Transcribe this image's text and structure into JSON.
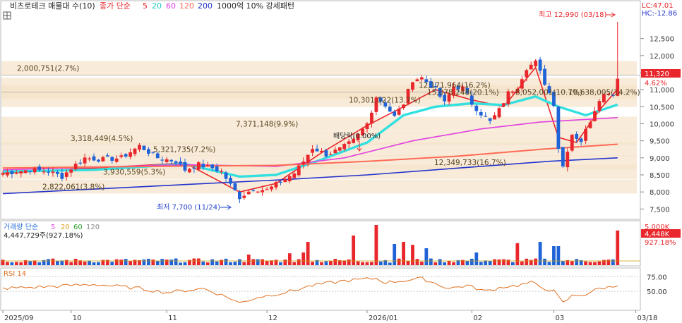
{
  "header": {
    "title": "비츠로테크 매물대 수(10)",
    "ma_label": "종가 단순",
    "ma_periods": [
      "5",
      "20",
      "60",
      "120",
      "200"
    ],
    "ma_colors": [
      "#e8262b",
      "#33e0e0",
      "#e040e0",
      "#ff6a55",
      "#2233cc"
    ],
    "overlay_label": "1000억 10% 강세패턴"
  },
  "corner": {
    "lc": "LC:47.01",
    "hc": "HC:-12.86"
  },
  "price_badge": {
    "value": "11,320",
    "pct": "4.62%"
  },
  "volume_badge": {
    "value": "4,448K",
    "pct": "927.18%"
  },
  "volume_header": {
    "label": "거래량 단순",
    "periods": [
      "5",
      "20",
      "60",
      "120"
    ],
    "info": "4,447,729주(927.18%)",
    "scale_top": "5,000K"
  },
  "rsi_header": {
    "label": "RSI 14"
  },
  "annotations": {
    "high": "최고 12,990 (03/18)",
    "low": "최저 7,700 (11/24)",
    "dividend": "배당락(0.00%)"
  },
  "chart_data": {
    "type": "candlestick",
    "price_axis": {
      "ylim": [
        7300,
        13300
      ],
      "ticks": [
        7500,
        8000,
        8500,
        9000,
        9500,
        10000,
        10500,
        11000,
        11500,
        12000,
        12500
      ],
      "tick_labels": [
        "7,500",
        "8,000",
        "8,500",
        "9,000",
        "9,500",
        "10,000",
        "10,500",
        "11,000",
        "11,500",
        "12,000",
        "12,500"
      ]
    },
    "x_axis": {
      "n_sessions": 136,
      "labels": [
        {
          "text": "2025/09",
          "index": 0
        },
        {
          "text": "10",
          "index": 15
        },
        {
          "text": "11",
          "index": 36
        },
        {
          "text": "12",
          "index": 58
        },
        {
          "text": "2026/01",
          "index": 80
        },
        {
          "text": "02",
          "index": 103
        },
        {
          "text": "03",
          "index": 121
        },
        {
          "text": "03/18",
          "index": 139
        }
      ]
    },
    "volume_profile": [
      {
        "text": "2,000,751(2.7%)",
        "price": 11630
      },
      {
        "text": "12,171,964(16.2%)",
        "price": 11140
      },
      {
        "text": "15,078,248(20.1%)",
        "price": 10930
      },
      {
        "text": "8,052,001(10.7%)",
        "price": 10930
      },
      {
        "text": "10,638,005(14.2%)",
        "price": 10930
      },
      {
        "text": "10,301,022(13.7%)",
        "price": 10700
      },
      {
        "text": "7,371,148(9.9%)",
        "price": 10000
      },
      {
        "text": "3,318,449(4.5%)",
        "price": 9580
      },
      {
        "text": "5,321,735(7.2%)",
        "price": 9260
      },
      {
        "text": "12,349,733(16.7%)",
        "price": 8870
      },
      {
        "text": "3,930,559(5.3%)",
        "price": 8590
      },
      {
        "text": "2,822,061(3.8%)",
        "price": 8160
      }
    ],
    "close_path": [
      [
        0,
        8550
      ],
      [
        6,
        8650
      ],
      [
        10,
        8600
      ],
      [
        13,
        8450
      ],
      [
        15,
        8700
      ],
      [
        18,
        9000
      ],
      [
        22,
        8950
      ],
      [
        26,
        9000
      ],
      [
        30,
        9350
      ],
      [
        34,
        9000
      ],
      [
        38,
        8900
      ],
      [
        40,
        8650
      ],
      [
        43,
        8800
      ],
      [
        46,
        8700
      ],
      [
        48,
        8600
      ],
      [
        50,
        8200
      ],
      [
        52,
        7850
      ],
      [
        55,
        8100
      ],
      [
        58,
        8050
      ],
      [
        61,
        8300
      ],
      [
        64,
        8550
      ],
      [
        66,
        8900
      ],
      [
        68,
        9300
      ],
      [
        71,
        9100
      ],
      [
        74,
        9250
      ],
      [
        77,
        9500
      ],
      [
        80,
        10000
      ],
      [
        82,
        10800
      ],
      [
        84,
        10550
      ],
      [
        86,
        10200
      ],
      [
        88,
        10600
      ],
      [
        90,
        11300
      ],
      [
        92,
        11350
      ],
      [
        95,
        11000
      ],
      [
        97,
        10600
      ],
      [
        99,
        11100
      ],
      [
        101,
        11050
      ],
      [
        103,
        10600
      ],
      [
        105,
        10300
      ],
      [
        107,
        10050
      ],
      [
        109,
        10400
      ],
      [
        111,
        10900
      ],
      [
        113,
        11100
      ],
      [
        115,
        11650
      ],
      [
        117,
        11800
      ],
      [
        119,
        11200
      ],
      [
        121,
        10600
      ],
      [
        122,
        9300
      ],
      [
        123,
        8750
      ],
      [
        124,
        9250
      ],
      [
        125,
        9700
      ],
      [
        127,
        9500
      ],
      [
        129,
        10100
      ],
      [
        131,
        10750
      ],
      [
        133,
        10950
      ],
      [
        134,
        10850
      ],
      [
        135,
        11320
      ]
    ],
    "last_candle": {
      "date": "03/18",
      "open": 10820,
      "high": 12990,
      "close": 11320
    },
    "moving_averages": [
      {
        "name": "5",
        "points": [
          [
            0,
            8550
          ],
          [
            20,
            8700
          ],
          [
            40,
            8850
          ],
          [
            52,
            8000
          ],
          [
            60,
            8250
          ],
          [
            70,
            9150
          ],
          [
            80,
            9950
          ],
          [
            88,
            10500
          ],
          [
            95,
            11000
          ],
          [
            103,
            10700
          ],
          [
            110,
            10500
          ],
          [
            117,
            11650
          ],
          [
            122,
            9600
          ],
          [
            126,
            9450
          ],
          [
            131,
            10400
          ],
          [
            135,
            11020
          ]
        ]
      },
      {
        "name": "20",
        "points": [
          [
            0,
            8600
          ],
          [
            20,
            8650
          ],
          [
            40,
            8820
          ],
          [
            52,
            8450
          ],
          [
            60,
            8500
          ],
          [
            70,
            8950
          ],
          [
            80,
            9450
          ],
          [
            88,
            10250
          ],
          [
            95,
            10500
          ],
          [
            103,
            10600
          ],
          [
            110,
            10550
          ],
          [
            117,
            10800
          ],
          [
            122,
            10500
          ],
          [
            128,
            10250
          ],
          [
            135,
            10560
          ]
        ]
      },
      {
        "name": "60",
        "points": [
          [
            0,
            8650
          ],
          [
            40,
            8800
          ],
          [
            60,
            8750
          ],
          [
            75,
            9000
          ],
          [
            90,
            9500
          ],
          [
            105,
            9850
          ],
          [
            118,
            10050
          ],
          [
            135,
            10180
          ]
        ]
      },
      {
        "name": "120",
        "points": [
          [
            0,
            8700
          ],
          [
            40,
            8760
          ],
          [
            60,
            8780
          ],
          [
            80,
            8900
          ],
          [
            100,
            9050
          ],
          [
            118,
            9250
          ],
          [
            135,
            9400
          ]
        ]
      },
      {
        "name": "200",
        "points": [
          [
            0,
            7950
          ],
          [
            30,
            8150
          ],
          [
            60,
            8350
          ],
          [
            80,
            8500
          ],
          [
            100,
            8700
          ],
          [
            120,
            8900
          ],
          [
            135,
            9000
          ]
        ]
      }
    ],
    "rsi": {
      "ticks": [
        50,
        75
      ],
      "tick_labels": [
        "50.00",
        "75.00"
      ],
      "points": [
        [
          0,
          55
        ],
        [
          10,
          58
        ],
        [
          20,
          62
        ],
        [
          30,
          55
        ],
        [
          36,
          48
        ],
        [
          44,
          55
        ],
        [
          50,
          38
        ],
        [
          52,
          30
        ],
        [
          56,
          40
        ],
        [
          62,
          48
        ],
        [
          68,
          60
        ],
        [
          75,
          68
        ],
        [
          82,
          72
        ],
        [
          84,
          65
        ],
        [
          90,
          70
        ],
        [
          92,
          72
        ],
        [
          98,
          55
        ],
        [
          102,
          60
        ],
        [
          106,
          50
        ],
        [
          110,
          58
        ],
        [
          113,
          60
        ],
        [
          116,
          65
        ],
        [
          118,
          58
        ],
        [
          121,
          50
        ],
        [
          123,
          30
        ],
        [
          125,
          42
        ],
        [
          128,
          45
        ],
        [
          131,
          55
        ],
        [
          134,
          58
        ],
        [
          135,
          62
        ]
      ]
    }
  }
}
